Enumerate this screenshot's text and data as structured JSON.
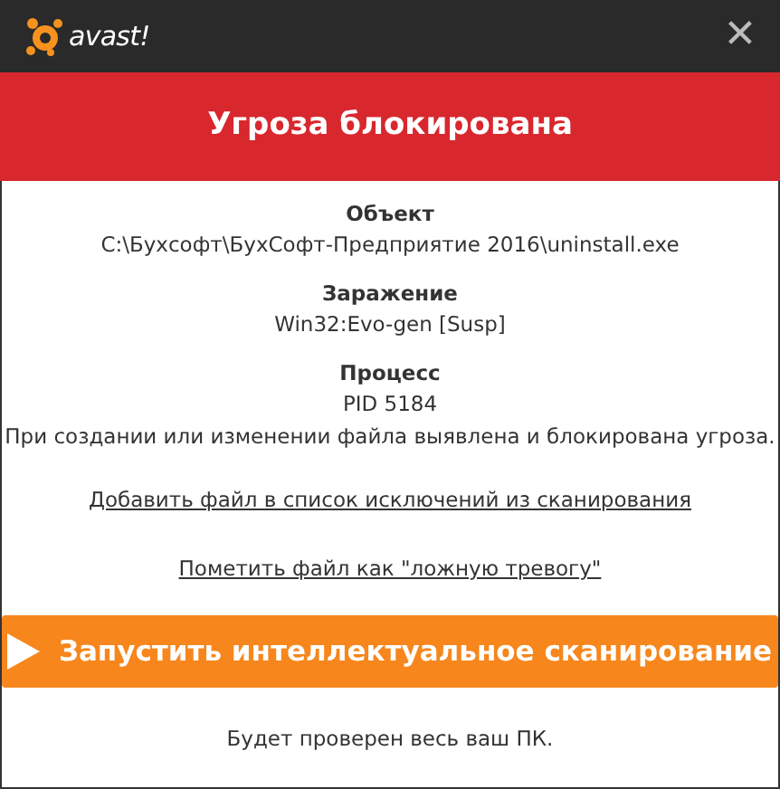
{
  "title_bar": {
    "logo_text": "avast!",
    "close": "✕"
  },
  "banner": {
    "title": "Угроза блокирована"
  },
  "details": [
    {
      "label": "Объект",
      "value": "C:\\Бухсофт\\БухСофт-Предприятие 2016\\uninstall.exe"
    },
    {
      "label": "Заражение",
      "value": "Win32:Evo-gen [Susp]"
    },
    {
      "label": "Процесс",
      "value": "PID 5184"
    }
  ],
  "message": "При создании или изменении файла выявлена и блокирована угроза.",
  "links": [
    "Добавить файл в список исключений из сканирования",
    "Пометить файл как \"ложную тревогу\""
  ],
  "scan_button": {
    "label": "Запустить интеллектуальное сканирование"
  },
  "footer_note": "Будет проверен весь ваш ПК."
}
